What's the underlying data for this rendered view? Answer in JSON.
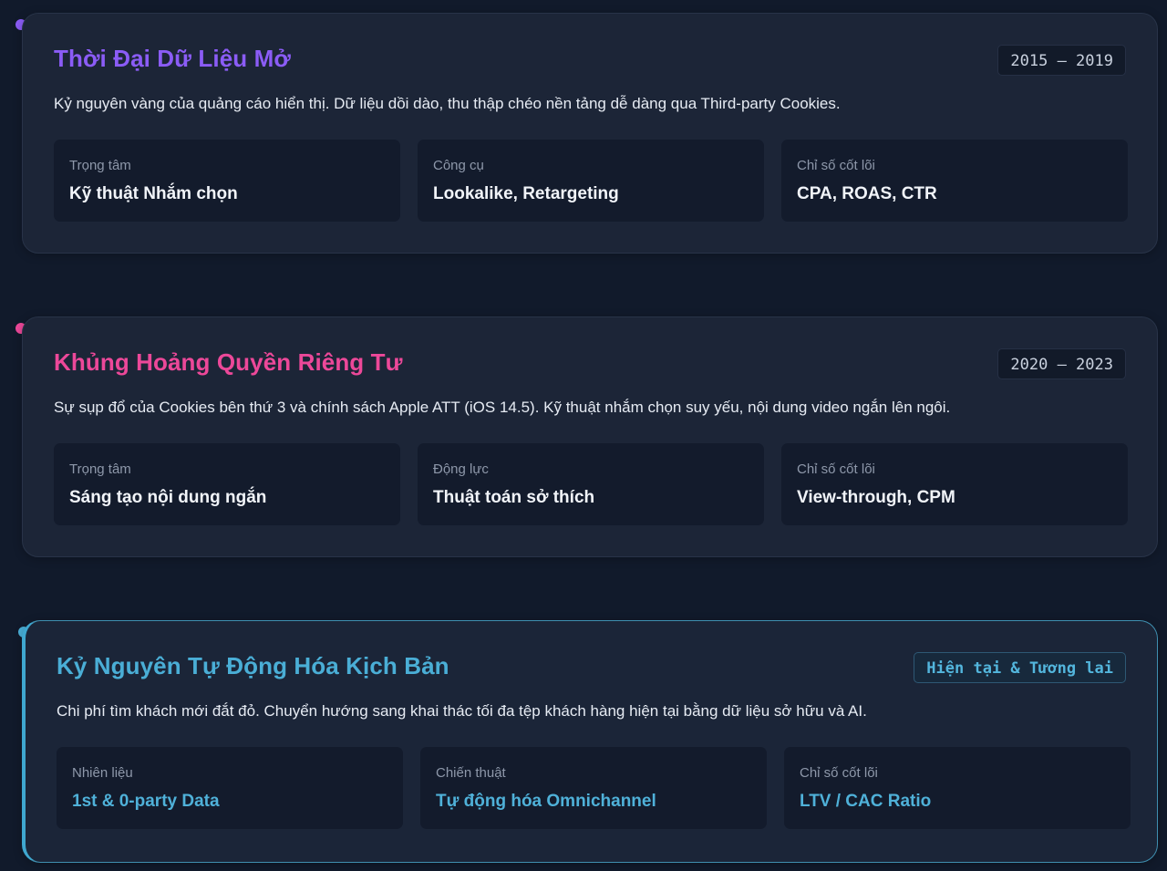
{
  "timeline": {
    "eras": [
      {
        "title": "Thời Đại Dữ Liệu Mở",
        "period": "2015 – 2019",
        "description": "Kỷ nguyên vàng của quảng cáo hiển thị. Dữ liệu dồi dào, thu thập chéo nền tảng dễ dàng qua Third-party Cookies.",
        "accent_color": "#8b5cf6",
        "cards": [
          {
            "label": "Trọng tâm",
            "value": "Kỹ thuật Nhắm chọn"
          },
          {
            "label": "Công cụ",
            "value": "Lookalike, Retargeting"
          },
          {
            "label": "Chỉ số cốt lõi",
            "value": "CPA, ROAS, CTR"
          }
        ]
      },
      {
        "title": "Khủng Hoảng Quyền Riêng Tư",
        "period": "2020 – 2023",
        "description": "Sự sụp đổ của Cookies bên thứ 3 và chính sách Apple ATT (iOS 14.5). Kỹ thuật nhắm chọn suy yếu, nội dung video ngắn lên ngôi.",
        "accent_color": "#ec4899",
        "cards": [
          {
            "label": "Trọng tâm",
            "value": "Sáng tạo nội dung ngắn"
          },
          {
            "label": "Động lực",
            "value": "Thuật toán sở thích"
          },
          {
            "label": "Chỉ số cốt lõi",
            "value": "View-through, CPM"
          }
        ]
      },
      {
        "title": "Kỷ Nguyên Tự Động Hóa Kịch Bản",
        "period": "Hiện tại & Tương lai",
        "description": "Chi phí tìm khách mới đắt đỏ. Chuyển hướng sang khai thác tối đa tệp khách hàng hiện tại bằng dữ liệu sở hữu và AI.",
        "accent_color": "#4aaed6",
        "cards": [
          {
            "label": "Nhiên liệu",
            "value": "1st & 0-party Data"
          },
          {
            "label": "Chiến thuật",
            "value": "Tự động hóa Omnichannel"
          },
          {
            "label": "Chỉ số cốt lõi",
            "value": "LTV / CAC Ratio"
          }
        ]
      }
    ]
  }
}
